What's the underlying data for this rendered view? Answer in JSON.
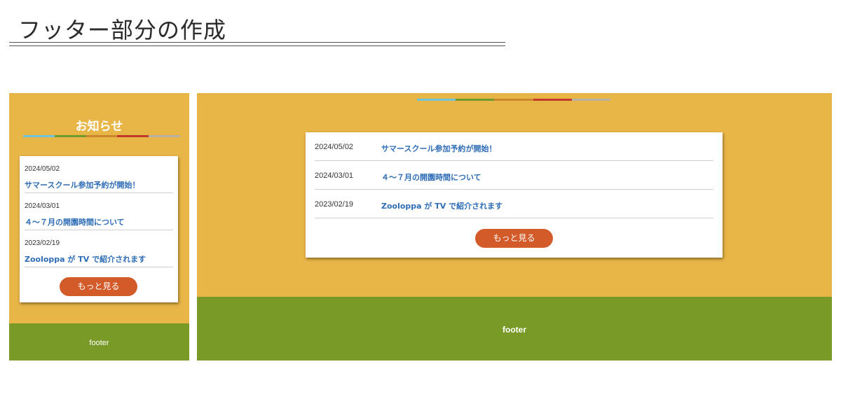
{
  "page": {
    "title": "フッター部分の作成"
  },
  "stripe_colors": [
    "#6fc3d9",
    "#6e9b2d",
    "#c9862c",
    "#c0392b",
    "#b8b1a3"
  ],
  "accent": {
    "panel_bg": "#e8b646",
    "footer_bg": "#7a9a27",
    "button_bg": "#d35b2a",
    "link": "#2e6db6"
  },
  "news": {
    "heading": "お知らせ",
    "items": [
      {
        "date": "2024/05/02",
        "title": "サマースクール参加予約が開始！"
      },
      {
        "date": "2024/03/01",
        "title": "４〜７月の開園時間について"
      },
      {
        "date": "2023/02/19",
        "title": "Zooloppa が TV で紹介されます"
      }
    ],
    "more_label": "もっと見る"
  },
  "footer": {
    "label": "footer"
  }
}
